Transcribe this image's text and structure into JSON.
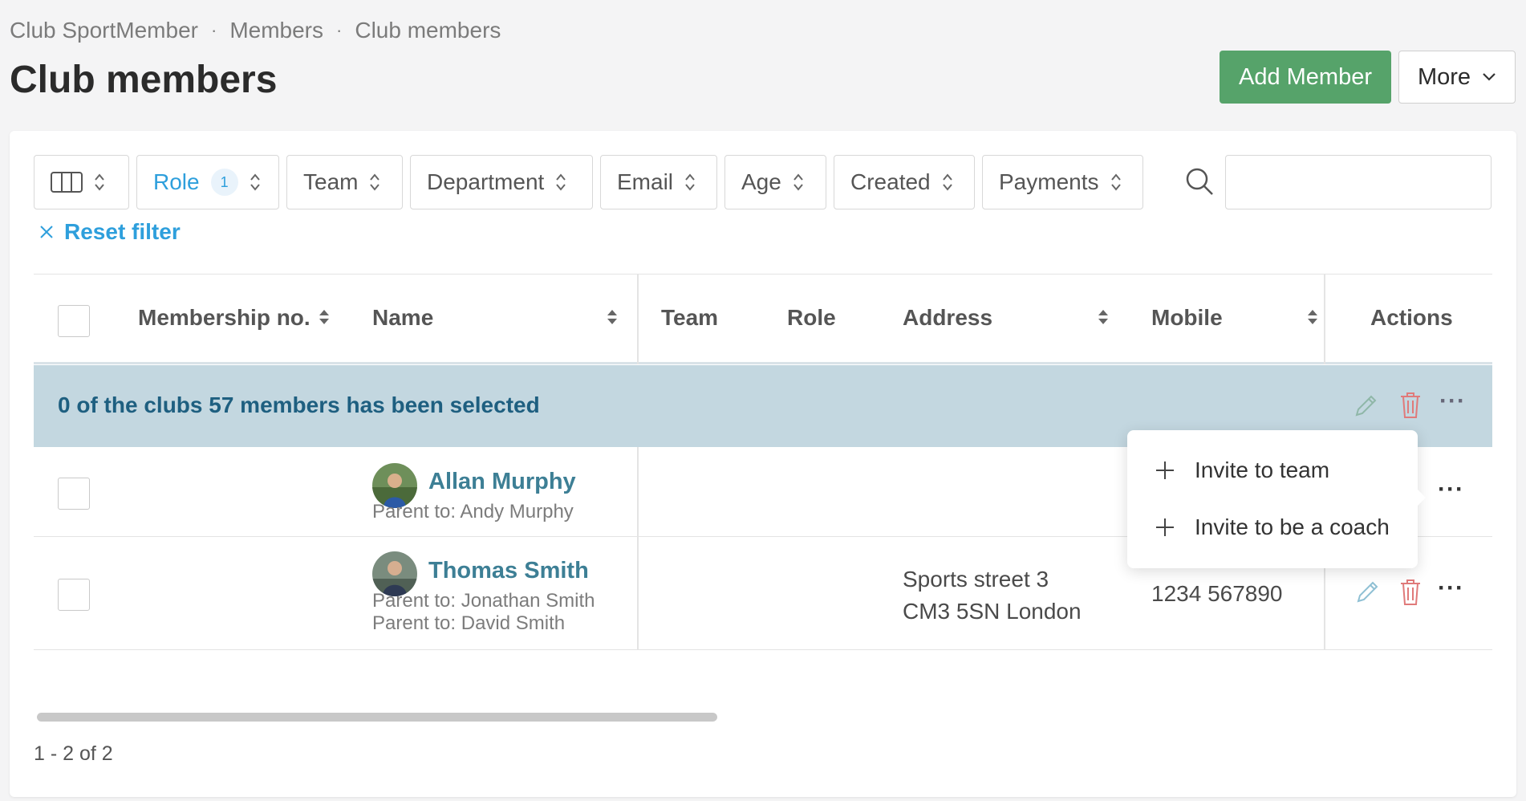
{
  "breadcrumb": {
    "items": [
      "Club SportMember",
      "Members",
      "Club members"
    ],
    "separator": "·"
  },
  "page": {
    "title": "Club members"
  },
  "toolbar": {
    "add_label": "Add Member",
    "more_label": "More"
  },
  "filters": {
    "chips": [
      {
        "label": "",
        "type": "columns"
      },
      {
        "label": "Role",
        "count": "1",
        "active": true
      },
      {
        "label": "Team"
      },
      {
        "label": "Department"
      },
      {
        "label": "Email"
      },
      {
        "label": "Age"
      },
      {
        "label": "Created"
      },
      {
        "label": "Payments"
      }
    ],
    "search_placeholder": "",
    "reset_label": "Reset filter"
  },
  "table": {
    "columns": [
      "Membership no.",
      "Name",
      "Team",
      "Role",
      "Address",
      "Mobile",
      "Actions"
    ],
    "selection_text": "0 of the clubs 57 members has been selected",
    "rows": [
      {
        "name": "Allan Murphy",
        "parents": [
          "Parent to: Andy Murphy"
        ],
        "address": [
          "",
          ""
        ],
        "mobile": ""
      },
      {
        "name": "Thomas Smith",
        "parents": [
          "Parent to: Jonathan Smith",
          "Parent to: David Smith"
        ],
        "address": [
          "Sports street 3",
          "CM3 5SN London"
        ],
        "mobile": "1234 567890"
      }
    ]
  },
  "dropdown": {
    "items": [
      "Invite to team",
      "Invite to be a coach"
    ]
  },
  "pagination": {
    "text": "1 - 2 of 2"
  },
  "colors": {
    "primary_green": "#56a36a",
    "link_blue": "#2e9fdc",
    "selection_bg": "#c3d7e0",
    "name_teal": "#3d7f95",
    "delete_red": "#e07a7a"
  }
}
